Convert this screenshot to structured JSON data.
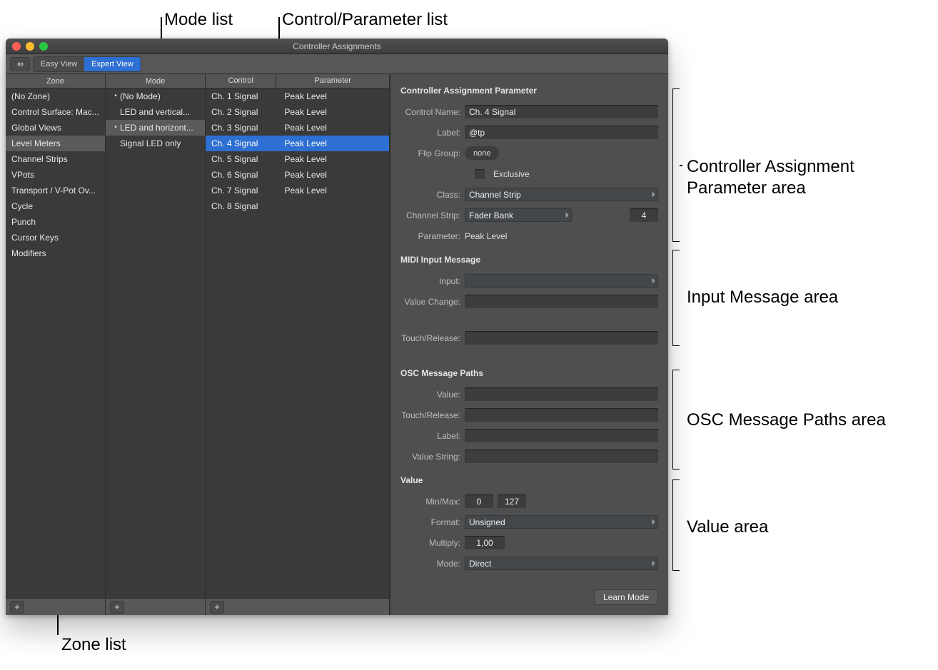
{
  "callouts": {
    "modeList": "Mode list",
    "controlParamList": "Control/Parameter list",
    "zoneList": "Zone list",
    "paramArea1": "Controller Assignment",
    "paramArea2": "Parameter area",
    "inputArea": "Input Message area",
    "oscArea": "OSC Message Paths area",
    "valueArea": "Value area"
  },
  "window": {
    "title": "Controller Assignments",
    "toolbar": {
      "easyView": "Easy View",
      "expertView": "Expert View"
    },
    "columns": {
      "zone": "Zone",
      "mode": "Mode",
      "control": "Control",
      "parameter": "Parameter"
    },
    "zoneItems": [
      "(No Zone)",
      "Control Surface: Mac...",
      "Global Views",
      "Level Meters",
      "Channel Strips",
      "VPots",
      "Transport / V-Pot Ov...",
      "Cycle",
      "Punch",
      "Cursor Keys",
      "Modifiers"
    ],
    "zoneSelectedIndex": 3,
    "modeItems": [
      {
        "bullet": true,
        "label": "(No Mode)"
      },
      {
        "bullet": false,
        "label": "LED and vertical..."
      },
      {
        "bullet": true,
        "label": "LED and horizont..."
      },
      {
        "bullet": false,
        "label": "Signal LED only"
      }
    ],
    "modeSelectedIndex": 2,
    "controlParamItems": [
      {
        "control": "Ch. 1 Signal",
        "parameter": "Peak Level"
      },
      {
        "control": "Ch. 2 Signal",
        "parameter": "Peak Level"
      },
      {
        "control": "Ch. 3 Signal",
        "parameter": "Peak Level"
      },
      {
        "control": "Ch. 4 Signal",
        "parameter": "Peak Level"
      },
      {
        "control": "Ch. 5 Signal",
        "parameter": "Peak Level"
      },
      {
        "control": "Ch. 6 Signal",
        "parameter": "Peak Level"
      },
      {
        "control": "Ch. 7 Signal",
        "parameter": "Peak Level"
      },
      {
        "control": "Ch. 8 Signal",
        "parameter": ""
      }
    ],
    "controlParamSelectedIndex": 3,
    "detail": {
      "section1": {
        "title": "Controller Assignment Parameter",
        "controlNameLabel": "Control Name:",
        "controlName": "Ch. 4 Signal",
        "labelLabel": "Label:",
        "label": "@tp",
        "flipGroupLabel": "Flip Group:",
        "flipGroup": "none",
        "exclusiveLabel": "Exclusive",
        "classLabel": "Class:",
        "class": "Channel Strip",
        "channelStripLabel": "Channel Strip:",
        "channelStrip": "Fader Bank",
        "channelStripNum": "4",
        "parameterLabel": "Parameter:",
        "parameter": "Peak Level"
      },
      "section2": {
        "title": "MIDI Input Message",
        "inputLabel": "Input:",
        "valueChangeLabel": "Value Change:",
        "touchReleaseLabel": "Touch/Release:"
      },
      "section3": {
        "title": "OSC Message Paths",
        "valueLabel": "Value:",
        "touchReleaseLabel": "Touch/Release:",
        "labelLabel": "Label:",
        "valueStringLabel": "Value String:"
      },
      "section4": {
        "title": "Value",
        "minMaxLabel": "Min/Max:",
        "min": "0",
        "max": "127",
        "formatLabel": "Format:",
        "format": "Unsigned",
        "multiplyLabel": "Multiply:",
        "multiply": "1,00",
        "modeLabel": "Mode:",
        "mode": "Direct"
      },
      "learnMode": "Learn Mode"
    }
  }
}
